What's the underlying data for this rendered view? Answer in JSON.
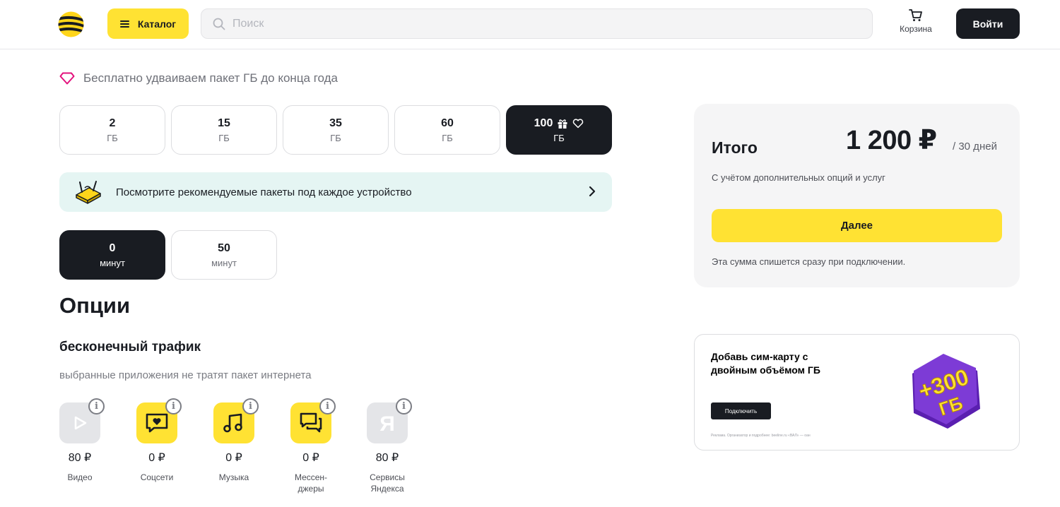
{
  "header": {
    "catalog_label": "Каталог",
    "search_placeholder": "Поиск",
    "cart_label": "Корзина",
    "login_label": "Войти"
  },
  "promo": {
    "text": "Бесплатно удваиваем пакет ГБ до конца года"
  },
  "gb_packages": [
    {
      "value": "2",
      "unit": "ГБ",
      "selected": false
    },
    {
      "value": "15",
      "unit": "ГБ",
      "selected": false
    },
    {
      "value": "35",
      "unit": "ГБ",
      "selected": false
    },
    {
      "value": "60",
      "unit": "ГБ",
      "selected": false
    },
    {
      "value": "100",
      "unit": "ГБ",
      "selected": true
    }
  ],
  "recommend": {
    "text": "Посмотрите рекомендуемые пакеты под каждое устройство"
  },
  "minutes": [
    {
      "value": "0",
      "unit": "минут",
      "selected": true
    },
    {
      "value": "50",
      "unit": "минут",
      "selected": false
    }
  ],
  "options": {
    "title": "Опции",
    "traffic_title": "бесконечный трафик",
    "traffic_subtitle": "выбранные приложения не тратят пакет интернета",
    "apps": [
      {
        "name": "Видео",
        "price": "80 ₽",
        "icon": "video-icon",
        "color": "#e4e5e8"
      },
      {
        "name": "Соцсети",
        "price": "0 ₽",
        "icon": "social-icon",
        "color": "#ffe233"
      },
      {
        "name": "Музыка",
        "price": "0 ₽",
        "icon": "music-icon",
        "color": "#ffe233"
      },
      {
        "name": "Мессен-\nджеры",
        "price": "0 ₽",
        "icon": "messenger-icon",
        "color": "#ffe233"
      },
      {
        "name": "Сервисы\nЯндекса",
        "price": "80 ₽",
        "icon": "yandex-icon",
        "color": "#e4e5e8"
      }
    ]
  },
  "summary": {
    "title": "Итого",
    "price": "1 200 ₽",
    "period": "/ 30 дней",
    "note": "С учётом дополнительных опций и услуг",
    "next_label": "Далее",
    "charge_note": "Эта сумма спишется сразу при подключении."
  },
  "ad": {
    "title": "Добавь сим-карту с двойным объёмом ГБ",
    "button_label": "Подключить",
    "legal": "Реклама. Организатор и подробнее: beeline.ru «ВАЛ» — оан",
    "badge_top": "+300",
    "badge_bottom": "ГБ"
  },
  "colors": {
    "brand_yellow": "#ffe233",
    "dark": "#191c22",
    "recommend_bg": "#e5f5f3",
    "promo_pink": "#e3127d",
    "badge_purple": "#7d3bd6"
  }
}
